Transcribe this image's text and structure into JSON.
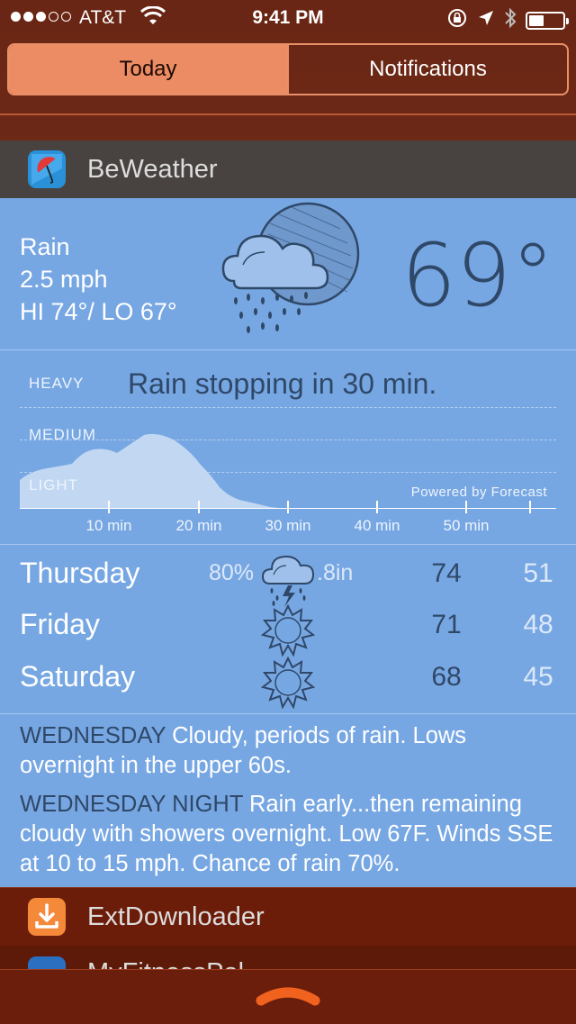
{
  "status_bar": {
    "carrier": "AT&T",
    "time": "9:41 PM",
    "signal_bars_filled": 3,
    "signal_bars_total": 5
  },
  "segments": {
    "today": "Today",
    "notifications": "Notifications",
    "selected": "Today"
  },
  "widgets": {
    "beweather": {
      "title": "BeWeather",
      "current": {
        "condition": "Rain",
        "wind": "2.5 mph",
        "hilo": "HI 74°/ LO 67°",
        "temperature": "69°",
        "icon": "rain-cloud-moon-icon"
      },
      "precip": {
        "labels": {
          "heavy": "HEAVY",
          "medium": "MEDIUM",
          "light": "LIGHT"
        },
        "message": "Rain stopping in 30 min.",
        "powered_by": "Powered by Forecast",
        "ticks": [
          "10 min",
          "20 min",
          "30 min",
          "40 min",
          "50 min"
        ]
      },
      "daily": [
        {
          "day": "Thursday",
          "precip_chance": "80%",
          "precip_amount": ".8in",
          "hi": "74",
          "lo": "51",
          "icon": "thunderstorm-icon"
        },
        {
          "day": "Friday",
          "precip_chance": "",
          "precip_amount": "",
          "hi": "71",
          "lo": "48",
          "icon": "sun-icon"
        },
        {
          "day": "Saturday",
          "precip_chance": "",
          "precip_amount": "",
          "hi": "68",
          "lo": "45",
          "icon": "sun-icon"
        }
      ],
      "forecast_text": [
        {
          "period": "WEDNESDAY",
          "text": " Cloudy, periods of rain. Lows overnight in the upper 60s."
        },
        {
          "period": "WEDNESDAY NIGHT",
          "text": " Rain early...then remaining cloudy with showers overnight. Low 67F. Winds SSE at 10 to 15 mph. Chance of rain 70%."
        }
      ]
    },
    "extdownloader": {
      "title": "ExtDownloader"
    },
    "next": {
      "title": "MyFitnessPal"
    }
  },
  "colors": {
    "background": "#6a2614",
    "accent": "#ec8c64",
    "weather_bg": "#77a7e3",
    "dark_text": "#2f4868"
  }
}
